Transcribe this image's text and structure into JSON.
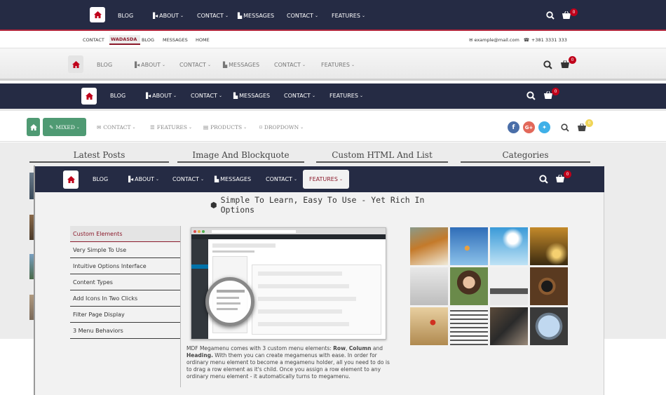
{
  "nav1": {
    "items": [
      {
        "label": "BLOG"
      },
      {
        "label": "ABOUT"
      },
      {
        "label": "CONTACT"
      },
      {
        "label": "MESSAGES"
      },
      {
        "label": "CONTACT"
      },
      {
        "label": "FEATURES"
      }
    ],
    "cart_count": "0"
  },
  "topbar": {
    "links": [
      "CONTACT",
      "WADASDA",
      "BLOG",
      "MESSAGES",
      "HOME"
    ],
    "email": "example@mail.com",
    "phone": "+381 3331 333"
  },
  "nav2": {
    "items": [
      {
        "label": "BLOG"
      },
      {
        "label": "ABOUT"
      },
      {
        "label": "CONTACT"
      },
      {
        "label": "MESSAGES"
      },
      {
        "label": "CONTACT"
      },
      {
        "label": "FEATURES"
      }
    ],
    "cart_count": "0"
  },
  "nav3": {
    "items": [
      {
        "label": "BLOG"
      },
      {
        "label": "ABOUT"
      },
      {
        "label": "CONTACT"
      },
      {
        "label": "MESSAGES"
      },
      {
        "label": "CONTACT"
      },
      {
        "label": "FEATURES"
      }
    ],
    "cart_count": "0"
  },
  "nav4": {
    "mixed_label": "MIXED",
    "items": [
      {
        "label": "CONTACT"
      },
      {
        "label": "FEATURES"
      },
      {
        "label": "PRODUCTS"
      },
      {
        "label": "DROPDOWN"
      }
    ],
    "cart_count": "0"
  },
  "sections": [
    "Latest Posts",
    "Image And Blockquote",
    "Custom HTML And List",
    "Categories"
  ],
  "nav5": {
    "items": [
      {
        "label": "BLOG"
      },
      {
        "label": "ABOUT"
      },
      {
        "label": "CONTACT"
      },
      {
        "label": "MESSAGES"
      },
      {
        "label": "CONTACT"
      },
      {
        "label": "FEATURES"
      }
    ],
    "cart_count": "0"
  },
  "mega": {
    "heading": "Simple To Learn, Easy To Use - Yet Rich In Options",
    "side_items": [
      "Custom Elements",
      "Very Simple To Use",
      "Intuitive Options Interface",
      "Content Types",
      "Add Icons In Two Clicks",
      "Filter Page Display",
      "3 Menu Behaviors"
    ],
    "desc_1": "MDF Megamenu comes with 3 custom menu elements: ",
    "desc_b1": "Row",
    "desc_2": ", ",
    "desc_b2": "Column",
    "desc_3": " and ",
    "desc_b3": "Heading.",
    "desc_4": " With them you can create megamenus with ease. In order for ordinary menu element to become a megamenu holder, all you need to do is to drag a row element as it's child. Once you assign a row element to any ordinary menu element - it automatically turns to megamenu."
  },
  "colors": {
    "nav_dark": "#252b44",
    "accent_red": "#c0001a",
    "mixed_green": "#4f9a73",
    "facebook": "#4a6ea8",
    "google": "#e2685a",
    "twitter": "#3fb0e8"
  }
}
